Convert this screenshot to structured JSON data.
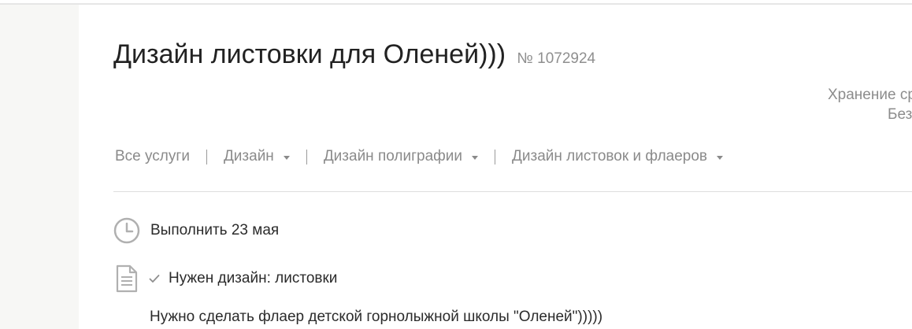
{
  "order": {
    "title": "Дизайн листовки для Оленей)))",
    "number": "№ 1072924"
  },
  "side_info": {
    "line1": "Хранение ср",
    "line2": "Без"
  },
  "breadcrumb": {
    "items": [
      {
        "label": "Все услуги",
        "has_dropdown": false
      },
      {
        "label": "Дизайн",
        "has_dropdown": true
      },
      {
        "label": "Дизайн полиграфии",
        "has_dropdown": true
      },
      {
        "label": "Дизайн листовок и флаеров",
        "has_dropdown": true
      }
    ]
  },
  "deadline": {
    "icon": "clock-icon",
    "text": "Выполнить 23 мая"
  },
  "requirements": {
    "icon": "document-icon",
    "check_icon": "check-icon",
    "item": "Нужен дизайн: листовки"
  },
  "description": "Нужно сделать флаер детской горнолыжной школы \"Оленей\")))))",
  "colors": {
    "text": "#222222",
    "muted": "#8a8a8a",
    "icon": "#b0b0b0",
    "divider": "#dddddd",
    "rail": "#f7f7f5"
  }
}
